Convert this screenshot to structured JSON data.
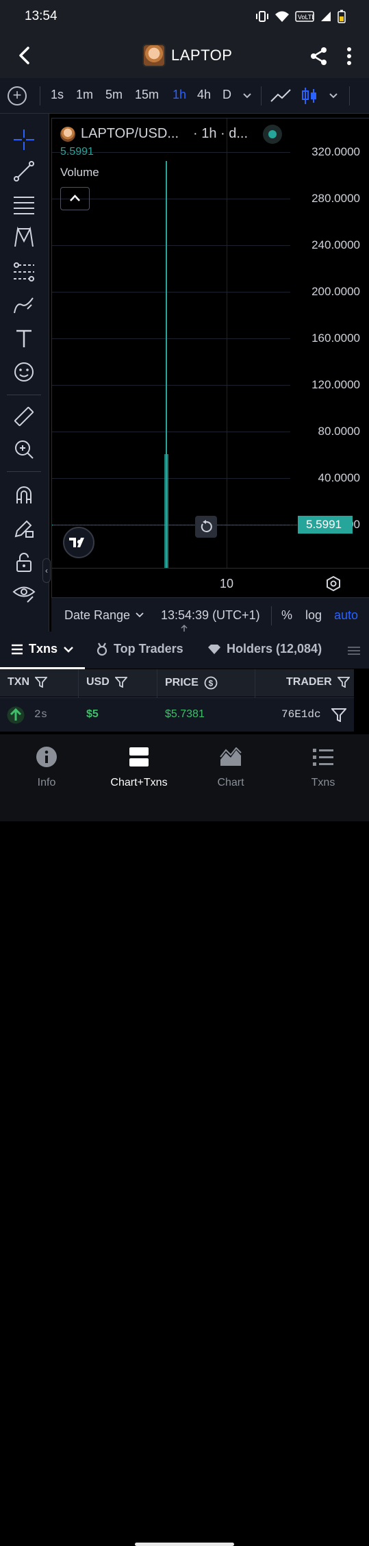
{
  "status": {
    "time": "13:54"
  },
  "header": {
    "title": "LAPTOP"
  },
  "timeframes": [
    "1s",
    "1m",
    "5m",
    "15m",
    "1h",
    "4h",
    "D"
  ],
  "active_timeframe": "1h",
  "chart": {
    "pair": "LAPTOP/USD...",
    "interval": "· 1h · d...",
    "last_price": "5.5991",
    "volume_label": "Volume",
    "y_ticks": [
      "320.0000",
      "280.0000",
      "240.0000",
      "200.0000",
      "160.0000",
      "120.0000",
      "80.0000",
      "40.0000",
      "0.0000"
    ],
    "price_tag": "5.5991",
    "x_label": "10",
    "live_color": "#26a69a"
  },
  "chart_bar": {
    "date_range": "Date Range",
    "clock": "13:54:39 (UTC+1)",
    "percent": "%",
    "log": "log",
    "auto": "auto"
  },
  "tabs": {
    "txns": "Txns",
    "top_traders": "Top Traders",
    "holders": "Holders (12,084)"
  },
  "table": {
    "headers": {
      "txn": "TXN",
      "usd": "USD",
      "price": "PRICE",
      "trader": "TRADER"
    },
    "rows": [
      {
        "age": "2s",
        "usd": "$5",
        "price": "$5.7381",
        "trader": "76E1dc"
      }
    ]
  },
  "nav": {
    "info": "Info",
    "chart_txns": "Chart+Txns",
    "chart": "Chart",
    "txns": "Txns"
  },
  "colors": {
    "accent": "#2962ff",
    "up": "#26a69a",
    "buy": "#3fbf6a",
    "panel": "#131722"
  }
}
